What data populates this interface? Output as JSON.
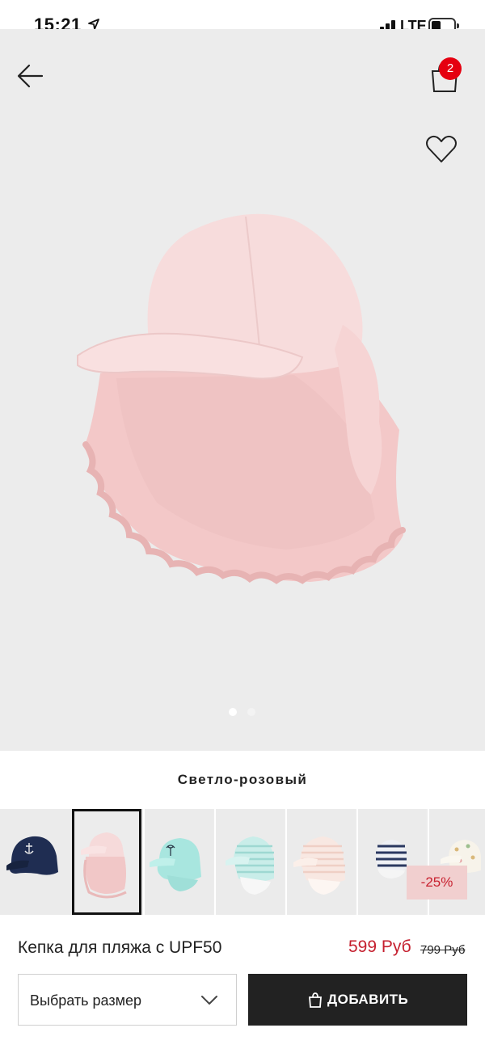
{
  "status_bar": {
    "time": "15:21",
    "network": "LTE"
  },
  "header": {
    "cart_count": "2"
  },
  "gallery": {
    "image_count": 2,
    "active_index": 0
  },
  "product": {
    "color_name": "Светло-розовый",
    "name": "Кепка для пляжа с UPF50",
    "price": "599 Руб",
    "old_price": "799 Руб"
  },
  "variants": {
    "selected_index": 1,
    "discount_badge": "-25%",
    "items": [
      {
        "icon": "navy-anchor-cap"
      },
      {
        "icon": "light-pink-cap"
      },
      {
        "icon": "mint-palm-cap"
      },
      {
        "icon": "mint-striped-cap"
      },
      {
        "icon": "peach-striped-cap"
      },
      {
        "icon": "navy-striped-cap"
      },
      {
        "icon": "floral-print-cap"
      }
    ]
  },
  "actions": {
    "size_select_label": "Выбрать размер",
    "add_button_label": "ДОБАВИТЬ"
  },
  "colors": {
    "accent_red": "#e50010",
    "price_red": "#c5202f",
    "button_dark": "#222222",
    "discount_bg": "#f1cfcf"
  },
  "icons": [
    "location-arrow-icon",
    "signal-icon",
    "battery-icon",
    "back-arrow-icon",
    "shopping-bag-icon",
    "heart-icon",
    "chevron-down-icon"
  ]
}
